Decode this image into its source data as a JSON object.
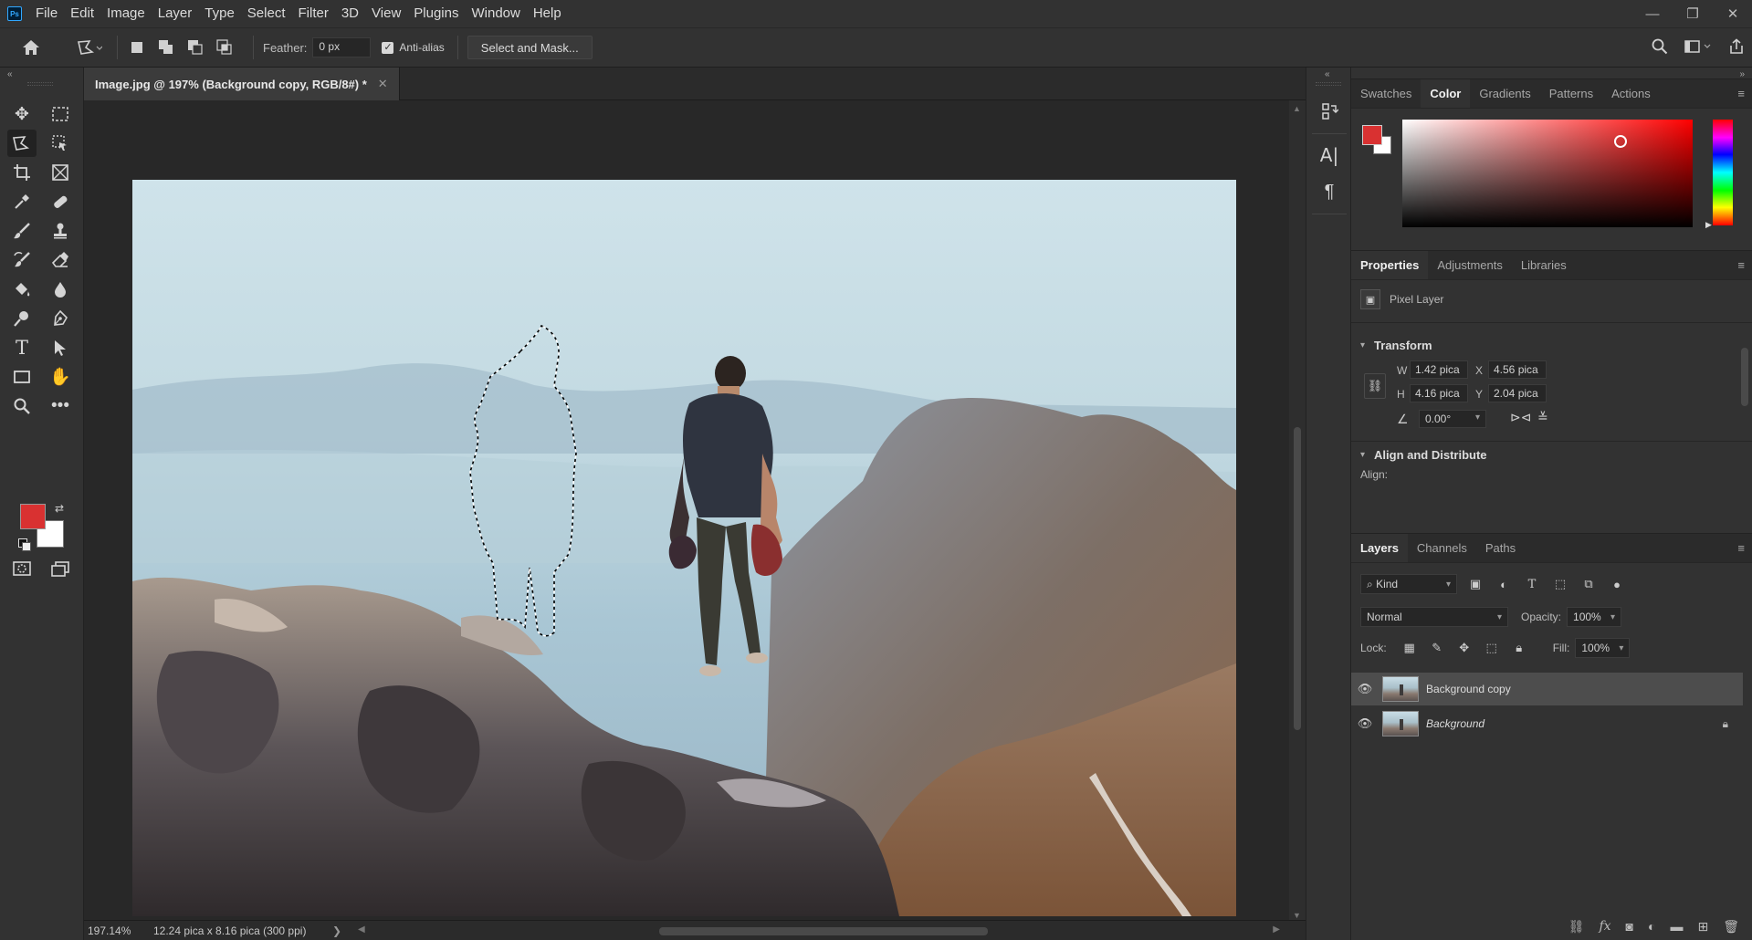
{
  "app": {
    "logo_text": "Ps"
  },
  "menu": [
    "File",
    "Edit",
    "Image",
    "Layer",
    "Type",
    "Select",
    "Filter",
    "3D",
    "View",
    "Plugins",
    "Window",
    "Help"
  ],
  "window_controls": {
    "minimize": "—",
    "restore": "❐",
    "close": "✕"
  },
  "options_bar": {
    "home_icon": "home-icon",
    "tool_icon": "polygonal-lasso-icon",
    "feather_label": "Feather:",
    "feather_value": "0 px",
    "anti_alias_label": "Anti-alias",
    "anti_alias_checked": true,
    "select_mask_label": "Select and Mask..."
  },
  "document": {
    "tab_title": "Image.jpg @ 197% (Background copy, RGB/8#) *",
    "tab_close": "✕"
  },
  "status": {
    "zoom": "197.14%",
    "doc_size": "12.24 pica x 8.16 pica (300 ppi)",
    "arrow": "❯"
  },
  "colors": {
    "foreground": "#d93131",
    "background": "#ffffff",
    "accent": "#31a8ff"
  },
  "color_panel": {
    "tabs": [
      "Swatches",
      "Color",
      "Gradients",
      "Patterns",
      "Actions"
    ],
    "active_tab": "Color"
  },
  "properties_panel": {
    "tabs": [
      "Properties",
      "Adjustments",
      "Libraries"
    ],
    "active_tab": "Properties",
    "layer_type": "Pixel Layer",
    "transform_title": "Transform",
    "w_label": "W",
    "w_value": "1.42 pica",
    "h_label": "H",
    "h_value": "4.16 pica",
    "x_label": "X",
    "x_value": "4.56 pica",
    "y_label": "Y",
    "y_value": "2.04 pica",
    "angle_value": "0.00°",
    "align_title": "Align and Distribute",
    "align_label": "Align:"
  },
  "layers_panel": {
    "tabs": [
      "Layers",
      "Channels",
      "Paths"
    ],
    "active_tab": "Layers",
    "kind_label": "Kind",
    "blend_mode": "Normal",
    "opacity_label": "Opacity:",
    "opacity_value": "100%",
    "lock_label": "Lock:",
    "fill_label": "Fill:",
    "fill_value": "100%",
    "layers": [
      {
        "name": "Background copy",
        "visible": true,
        "selected": true,
        "locked": false
      },
      {
        "name": "Background",
        "visible": true,
        "selected": false,
        "locked": true
      }
    ]
  }
}
